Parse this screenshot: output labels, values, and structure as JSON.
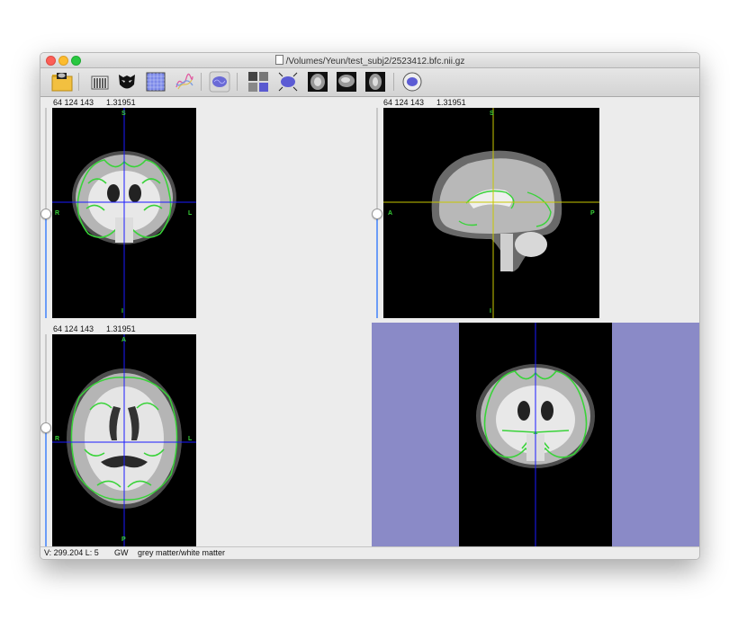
{
  "window": {
    "title": "/Volumes/Yeun/test_subj2/2523412.bfc.nii.gz"
  },
  "toolbar": {
    "buttons": [
      {
        "name": "open-folder-button",
        "icon": "folder-brain-icon"
      },
      {
        "name": "stack-button",
        "icon": "stack-icon"
      },
      {
        "name": "mask-button",
        "icon": "mask-icon"
      },
      {
        "name": "grid-button",
        "icon": "grid-icon"
      },
      {
        "name": "curves-button",
        "icon": "curves-icon"
      },
      {
        "name": "surface-button",
        "icon": "brain-surface-icon"
      },
      {
        "name": "layout-button",
        "icon": "layout-icon"
      },
      {
        "name": "brain-network-button",
        "icon": "brain-network-icon"
      },
      {
        "name": "slice-view-1-button",
        "icon": "slice-icon"
      },
      {
        "name": "slice-view-2-button",
        "icon": "slice-icon"
      },
      {
        "name": "slice-view-3-button",
        "icon": "slice-icon"
      },
      {
        "name": "rotate-brain-button",
        "icon": "rotate-brain-icon"
      }
    ]
  },
  "views": {
    "coronal": {
      "coords": "64 124 143",
      "intensity": "1.31951",
      "labels": {
        "top": "S",
        "bottom": "I",
        "left": "R",
        "right": "L"
      }
    },
    "sagittal": {
      "coords": "64 124 143",
      "intensity": "1.31951",
      "labels": {
        "top": "S",
        "bottom": "I",
        "left": "A",
        "right": "P"
      }
    },
    "axial": {
      "coords": "64 124 143",
      "intensity": "1.31951",
      "labels": {
        "top": "A",
        "bottom": "P",
        "left": "R",
        "right": "L"
      }
    }
  },
  "status": {
    "value": "V: 299.204 L: 5",
    "label_code": "GW",
    "label_name": "grey matter/white matter"
  },
  "colors": {
    "crosshair_coronal": "#1a1aff",
    "crosshair_sagittal": "#c8c800",
    "label_green": "#39d339",
    "render_bg": "#8a8ac7",
    "slider_fill": "#6b9cf7"
  }
}
